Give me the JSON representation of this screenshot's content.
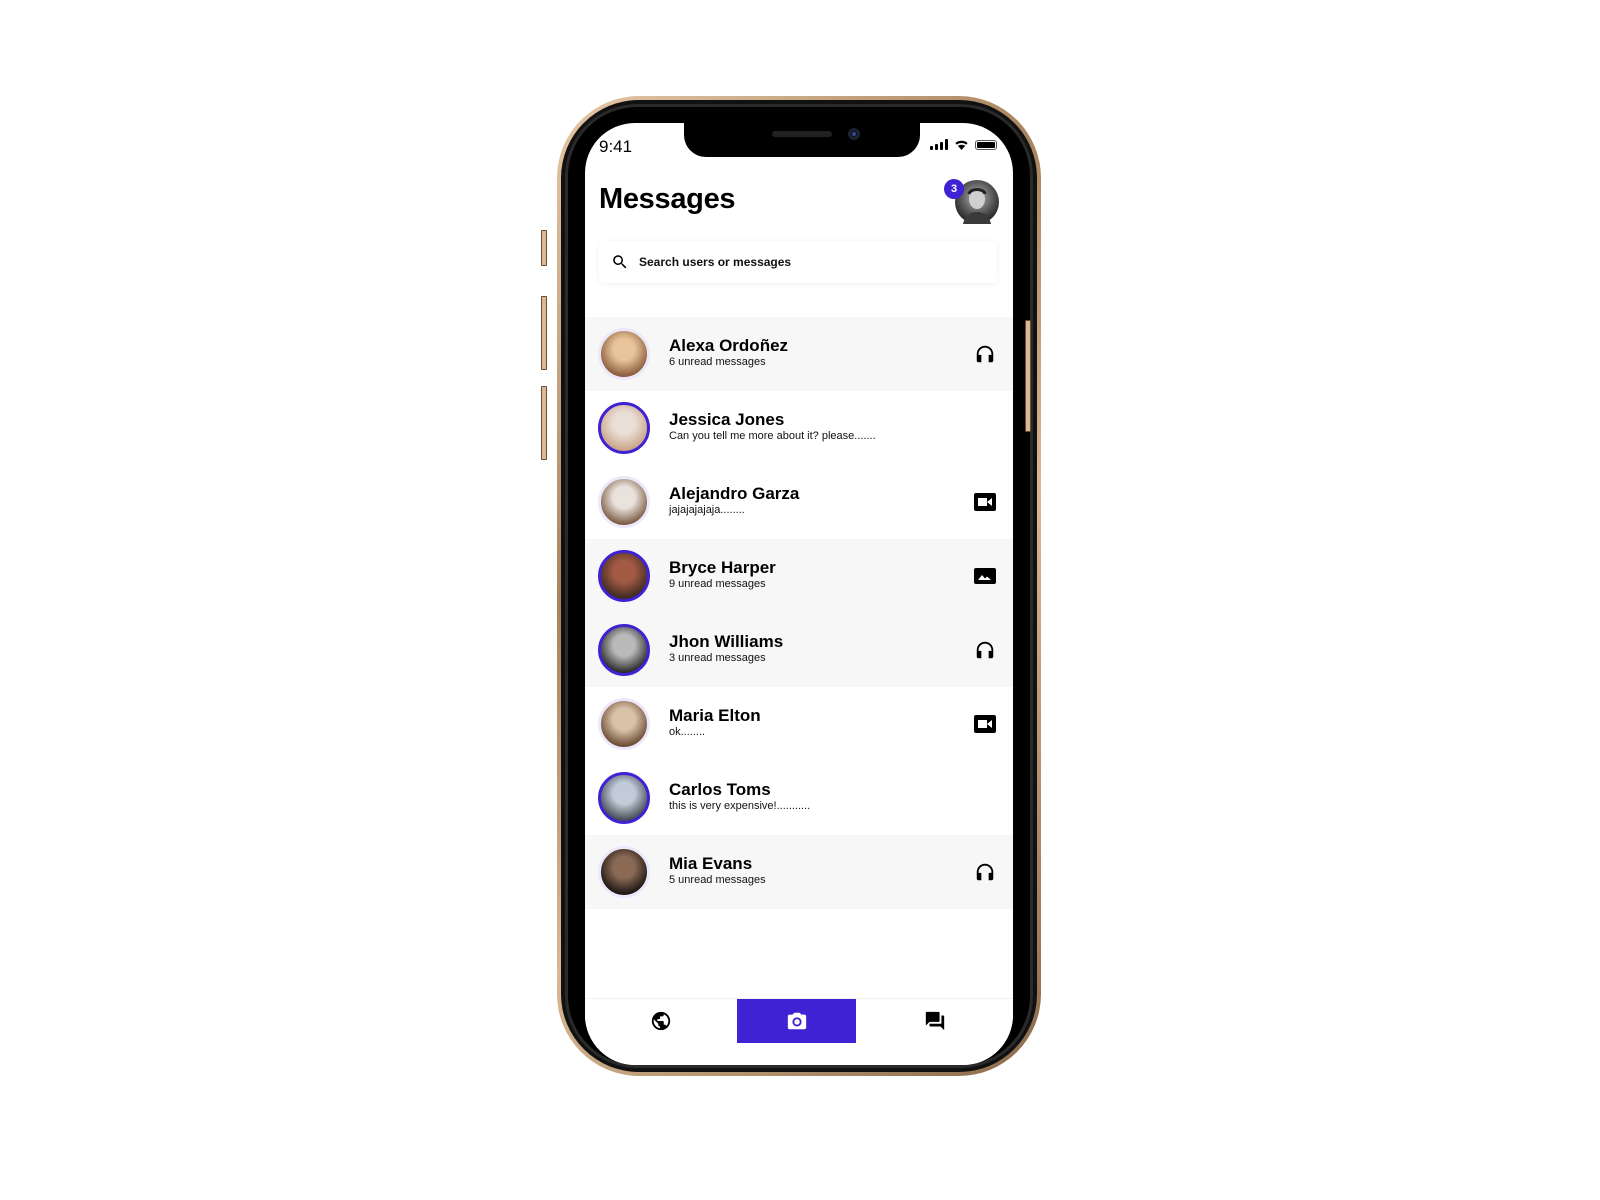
{
  "status_bar": {
    "time": "9:41"
  },
  "header": {
    "title": "Messages",
    "notification_count": "3"
  },
  "search": {
    "placeholder": "Search users or messages",
    "value": ""
  },
  "colors": {
    "accent": "#3f22d3",
    "row_shaded": "#f7f7f7"
  },
  "conversations": [
    {
      "name": "Alexa Ordoñez",
      "subtitle": "6 unread messages",
      "icon": "headphones-icon",
      "ring": false,
      "shaded": true
    },
    {
      "name": "Jessica Jones",
      "subtitle": "Can you tell me more about it? please.......",
      "icon": "",
      "ring": true,
      "shaded": false
    },
    {
      "name": "Alejandro Garza",
      "subtitle": "jajajajajaja........",
      "icon": "video-icon",
      "ring": false,
      "shaded": false
    },
    {
      "name": "Bryce Harper",
      "subtitle": "9 unread messages",
      "icon": "image-icon",
      "ring": true,
      "shaded": true
    },
    {
      "name": "Jhon Williams",
      "subtitle": "3 unread messages",
      "icon": "headphones-icon",
      "ring": true,
      "shaded": true
    },
    {
      "name": "Maria Elton",
      "subtitle": "ok........",
      "icon": "video-icon",
      "ring": false,
      "shaded": false
    },
    {
      "name": "Carlos Toms",
      "subtitle": "this is very expensive!...........",
      "icon": "",
      "ring": true,
      "shaded": false
    },
    {
      "name": "Mia Evans",
      "subtitle": "5 unread messages",
      "icon": "headphones-icon",
      "ring": false,
      "shaded": true
    }
  ],
  "tabbar": {
    "tabs": [
      {
        "icon": "globe-icon",
        "active": false
      },
      {
        "icon": "camera-icon",
        "active": true
      },
      {
        "icon": "chat-icon",
        "active": false
      }
    ]
  }
}
